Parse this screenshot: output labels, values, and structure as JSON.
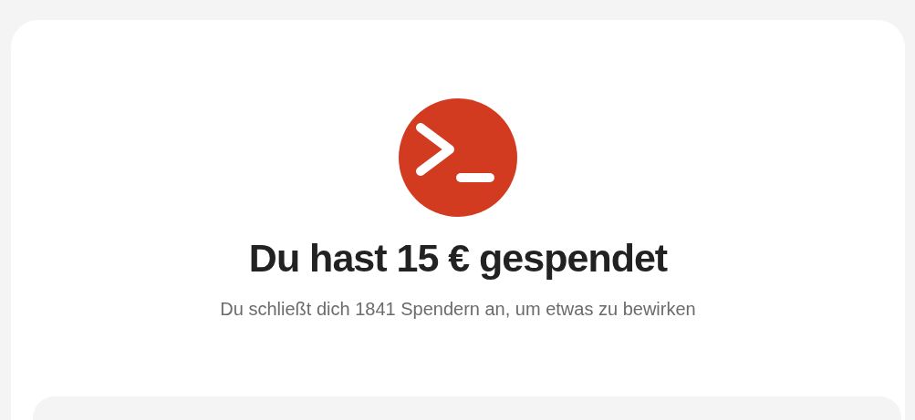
{
  "confirmation": {
    "title": "Du hast 15 € gespendet",
    "subtitle": "Du schließt dich 1841 Spendern an, um etwas zu bewirken"
  }
}
